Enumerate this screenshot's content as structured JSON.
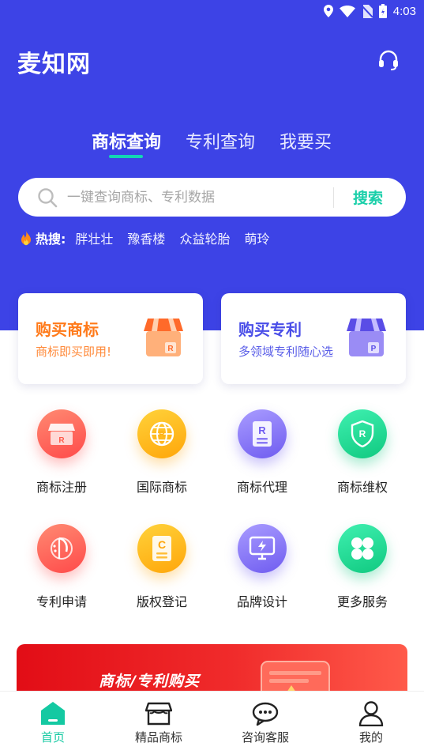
{
  "status_bar": {
    "time": "4:03"
  },
  "header": {
    "logo": "麦知网",
    "support_icon": "headset-icon"
  },
  "tabs": [
    {
      "label": "商标查询",
      "active": true
    },
    {
      "label": "专利查询",
      "active": false
    },
    {
      "label": "我要买",
      "active": false
    }
  ],
  "search": {
    "placeholder": "一键查询商标、专利数据",
    "value": "",
    "button": "搜索"
  },
  "hot": {
    "label": "热搜:",
    "items": [
      "胖壮壮",
      "豫香楼",
      "众益轮胎",
      "萌玲"
    ]
  },
  "cards": [
    {
      "title": "购买商标",
      "subtitle": "商标即买即用!",
      "icon": "trademark-shop-icon",
      "color": "#ff7a1a"
    },
    {
      "title": "购买专利",
      "subtitle": "多领域专利随心选",
      "icon": "patent-shop-icon",
      "color": "#4a4ee8"
    }
  ],
  "services": [
    {
      "label": "商标注册",
      "icon": "trademark-store-icon"
    },
    {
      "label": "国际商标",
      "icon": "globe-icon"
    },
    {
      "label": "商标代理",
      "icon": "document-r-icon"
    },
    {
      "label": "商标维权",
      "icon": "shield-r-icon"
    },
    {
      "label": "专利申请",
      "icon": "patent-icon"
    },
    {
      "label": "版权登记",
      "icon": "copyright-icon"
    },
    {
      "label": "品牌设计",
      "icon": "monitor-icon"
    },
    {
      "label": "更多服务",
      "icon": "grid-icon"
    }
  ],
  "banner": {
    "text": "商标/专利购买"
  },
  "bottom_nav": [
    {
      "label": "首页",
      "icon": "home-icon",
      "active": true
    },
    {
      "label": "精品商标",
      "icon": "store-icon",
      "active": false
    },
    {
      "label": "咨询客服",
      "icon": "chat-icon",
      "active": false
    },
    {
      "label": "我的",
      "icon": "user-icon",
      "active": false
    }
  ],
  "colors": {
    "brand_blue": "#3d43e6",
    "accent_green": "#14c9a2",
    "orange": "#ff7a1a"
  }
}
